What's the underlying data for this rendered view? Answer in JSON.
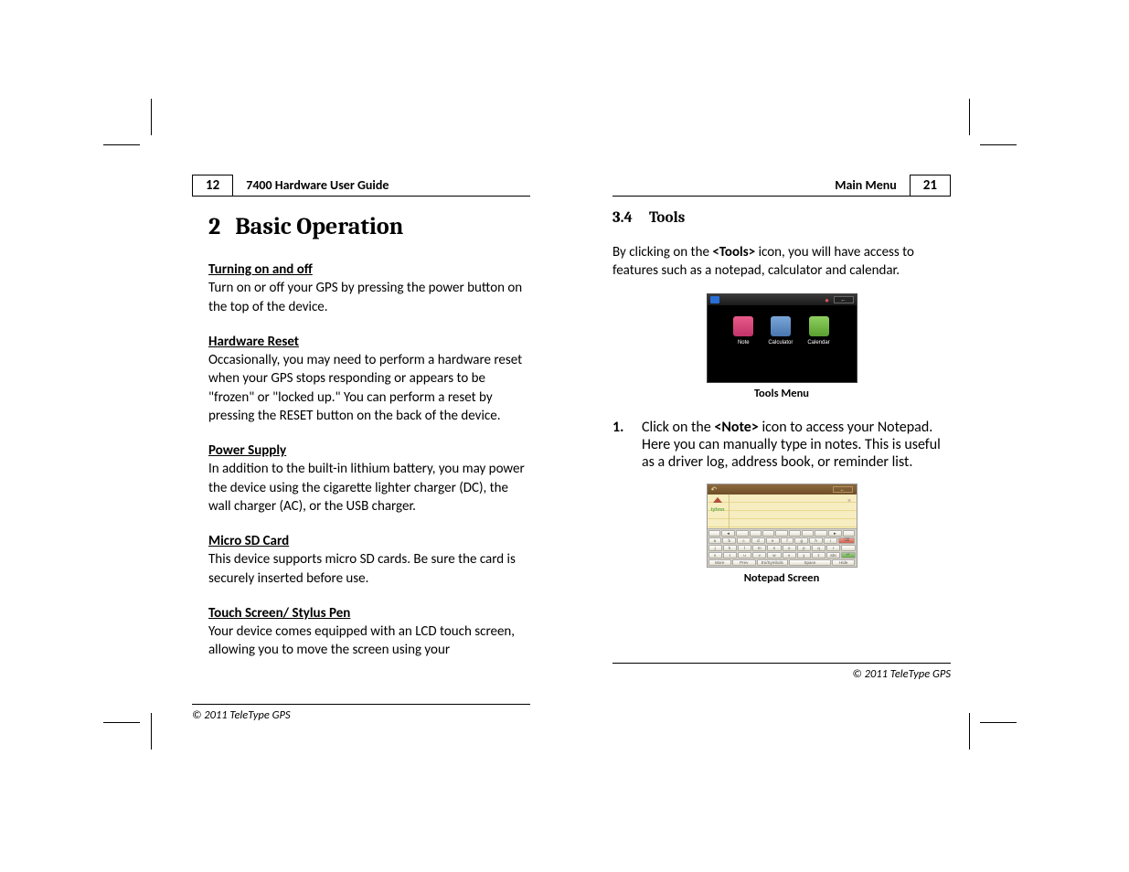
{
  "left": {
    "page_num": "12",
    "header_title": "7400 Hardware User Guide",
    "chapter_num": "2",
    "chapter_title": "Basic Operation",
    "sections": [
      {
        "heading": "Turning on and off ",
        "body": "Turn on or off your GPS by pressing the power button on the top of the device."
      },
      {
        "heading": "Hardware Reset",
        "body": "Occasionally, you may need to perform a hardware reset when your GPS stops responding or appears to be \"frozen\" or \"locked up.\" You can perform a reset by pressing the RESET button on the back of the device."
      },
      {
        "heading": "Power Supply",
        "body": "In addition to the built-in lithium battery, you may power the device using the cigarette lighter charger (DC), the wall charger (AC), or the USB charger."
      },
      {
        "heading": "Micro SD Card",
        "body": "This device supports micro SD cards. Be sure the card is securely inserted before use."
      },
      {
        "heading": "Touch Screen/ Stylus Pen",
        "body": "Your device comes equipped with an LCD touch screen, allowing you to move the screen using your"
      }
    ],
    "footer": "© 2011 TeleType GPS"
  },
  "right": {
    "page_num": "21",
    "header_title": "Main Menu",
    "section_num": "3.4",
    "section_title": "Tools",
    "intro_pre": "By clicking on the ",
    "intro_bold": "<Tools>",
    "intro_post": " icon, you will have access to features such as a notepad, calculator and calendar.",
    "fig1_caption": "Tools Menu",
    "tools_icons": [
      {
        "label": "Note",
        "color": "linear-gradient(#e85a8a,#c2336a)"
      },
      {
        "label": "Calculator",
        "color": "linear-gradient(#7aa6d8,#4a76b0)"
      },
      {
        "label": "Calendar",
        "color": "linear-gradient(#8fd060,#5aa030)"
      }
    ],
    "step1_num": "1.",
    "step1_pre": "Click on the ",
    "step1_bold": "<Note>",
    "step1_post": " icon to access your Notepad. Here you can manually type in notes. This is useful as a driver log, address book, or reminder list.",
    "fig2_caption": "Notepad Screen",
    "notepad_side_label": "tyhnn",
    "keyboard": {
      "row1": [
        "",
        "◄",
        "",
        "",
        "",
        "",
        "",
        "",
        "",
        "►",
        ""
      ],
      "row2": [
        "a",
        "b",
        "c",
        "d",
        "e",
        "f",
        "g",
        "h",
        "i"
      ],
      "row3": [
        "j",
        "k",
        "l",
        "m",
        "n",
        "o",
        "p",
        "q",
        "r"
      ],
      "row4": [
        "s",
        "t",
        "u",
        "v",
        "w",
        "x",
        "y",
        "z",
        "abc"
      ],
      "row5": [
        "More",
        "Prev",
        "En/Symbols",
        "Space",
        "Hide"
      ]
    },
    "footer": "© 2011 TeleType GPS"
  }
}
